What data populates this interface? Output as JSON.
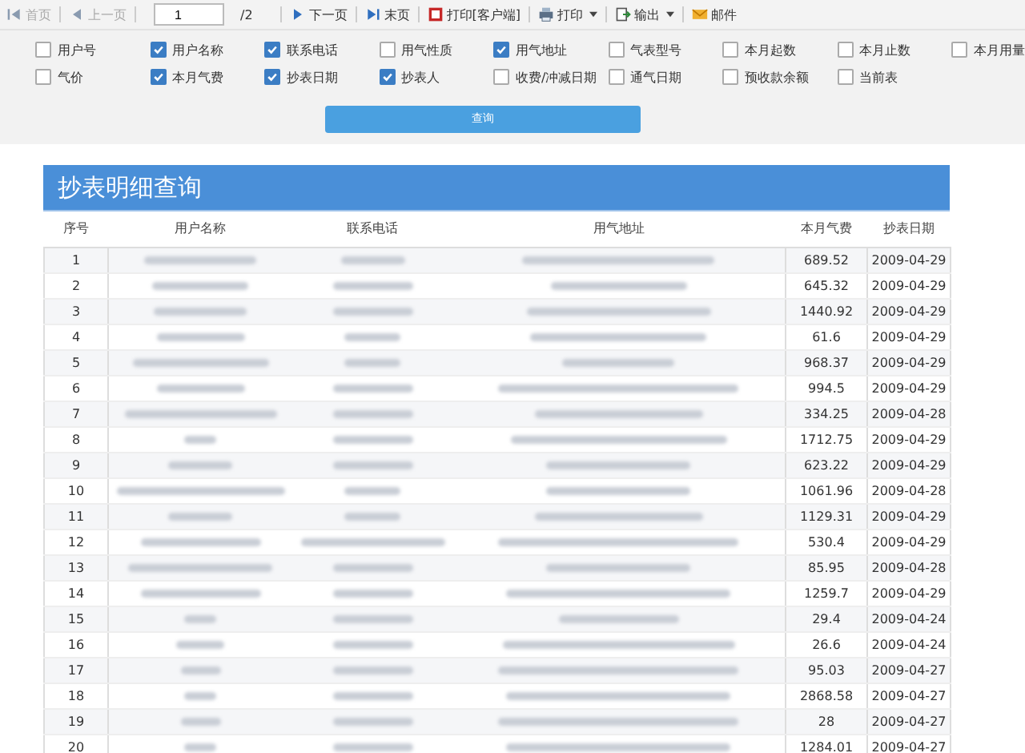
{
  "toolbar": {
    "items": [
      {
        "kind": "nav",
        "label": "首页",
        "disabled": true
      },
      {
        "kind": "nav",
        "label": "上一页",
        "disabled": true
      },
      {
        "kind": "page",
        "value": "1",
        "total": "/2"
      },
      {
        "kind": "nav",
        "label": "下一页",
        "disabled": false
      },
      {
        "kind": "nav",
        "label": "末页",
        "disabled": false
      },
      {
        "kind": "nav",
        "label": "打印[客户端]",
        "disabled": false
      },
      {
        "kind": "menu",
        "label": "打印"
      },
      {
        "kind": "menu",
        "label": "输出"
      },
      {
        "kind": "nav",
        "label": "邮件",
        "disabled": false
      }
    ]
  },
  "fields": [
    {
      "label": "用户号",
      "checked": false
    },
    {
      "label": "用户名称",
      "checked": true
    },
    {
      "label": "联系电话",
      "checked": true
    },
    {
      "label": "用气性质",
      "checked": false
    },
    {
      "label": "用气地址",
      "checked": true
    },
    {
      "label": "气表型号",
      "checked": false
    },
    {
      "label": "本月起数",
      "checked": false
    },
    {
      "label": "本月止数",
      "checked": false
    },
    {
      "label": "本月用量",
      "checked": false
    },
    {
      "label": "气价",
      "checked": false
    },
    {
      "label": "本月气费",
      "checked": true
    },
    {
      "label": "抄表日期",
      "checked": true
    },
    {
      "label": "抄表人",
      "checked": true
    },
    {
      "label": "收费/冲减日期",
      "checked": false
    },
    {
      "label": "通气日期",
      "checked": false
    },
    {
      "label": "预收款余额",
      "checked": false
    },
    {
      "label": "当前表",
      "checked": false
    }
  ],
  "query_button": "查询",
  "panel": {
    "title": "抄表明细查询",
    "columns": [
      "序号",
      "用户名称",
      "联系电话",
      "用气地址",
      "本月气费",
      "抄表日期"
    ],
    "rows": [
      {
        "no": "1",
        "fee": "689.52",
        "date": "2009-04-29"
      },
      {
        "no": "2",
        "fee": "645.32",
        "date": "2009-04-29"
      },
      {
        "no": "3",
        "fee": "1440.92",
        "date": "2009-04-29"
      },
      {
        "no": "4",
        "fee": "61.6",
        "date": "2009-04-29"
      },
      {
        "no": "5",
        "fee": "968.37",
        "date": "2009-04-29"
      },
      {
        "no": "6",
        "fee": "994.5",
        "date": "2009-04-29"
      },
      {
        "no": "7",
        "fee": "334.25",
        "date": "2009-04-28"
      },
      {
        "no": "8",
        "fee": "1712.75",
        "date": "2009-04-29"
      },
      {
        "no": "9",
        "fee": "623.22",
        "date": "2009-04-29"
      },
      {
        "no": "10",
        "fee": "1061.96",
        "date": "2009-04-28"
      },
      {
        "no": "11",
        "fee": "1129.31",
        "date": "2009-04-29"
      },
      {
        "no": "12",
        "fee": "530.4",
        "date": "2009-04-29"
      },
      {
        "no": "13",
        "fee": "85.95",
        "date": "2009-04-28"
      },
      {
        "no": "14",
        "fee": "1259.7",
        "date": "2009-04-29"
      },
      {
        "no": "15",
        "fee": "29.4",
        "date": "2009-04-24"
      },
      {
        "no": "16",
        "fee": "26.6",
        "date": "2009-04-24"
      },
      {
        "no": "17",
        "fee": "95.03",
        "date": "2009-04-27"
      },
      {
        "no": "18",
        "fee": "2868.58",
        "date": "2009-04-27"
      },
      {
        "no": "19",
        "fee": "28",
        "date": "2009-04-27"
      },
      {
        "no": "20",
        "fee": "1284.01",
        "date": "2009-04-27"
      }
    ]
  }
}
